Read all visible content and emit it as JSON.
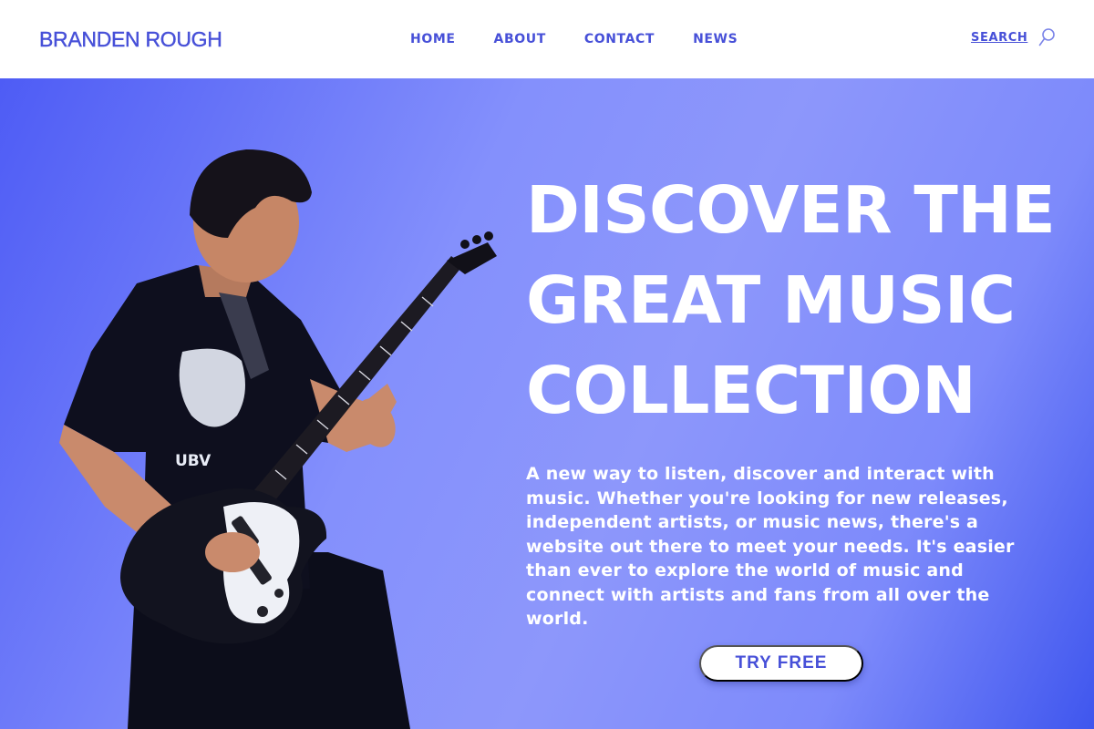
{
  "header": {
    "brand": "BRANDEN ROUGH",
    "nav": [
      "HOME",
      "ABOUT",
      "CONTACT",
      "NEWS"
    ],
    "search_label": "SEARCH",
    "search_icon": "search-icon"
  },
  "hero": {
    "headline_lines": [
      "DISCOVER THE",
      "GREAT MUSIC",
      "COLLECTION"
    ],
    "description": "A new way to listen, discover and interact with music. Whether you're looking for new releases, independent artists, or music news, there's a website out there to meet your needs. It's easier than ever to explore the world of music and connect with artists and fans from all over the world.",
    "cta_label": "TRY FREE",
    "shirt_print": "UBV"
  },
  "colors": {
    "accent": "#4750d8",
    "hero_gradient_start": "#4e5cf5",
    "hero_gradient_mid": "#8d97fb",
    "hero_gradient_end": "#3f56ee",
    "text_light": "#ffffff"
  }
}
